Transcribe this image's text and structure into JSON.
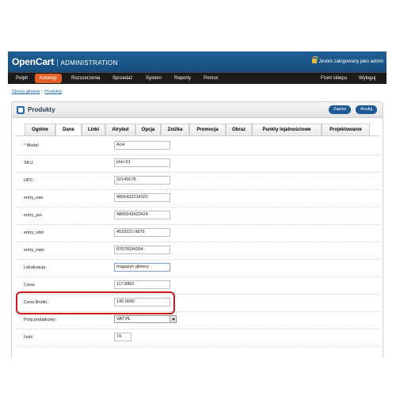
{
  "header": {
    "brand": "OpenCart",
    "separator": "|",
    "admin_label": "ADMINISTRATION",
    "logged_in": "Jesteś zalogowany jako admin"
  },
  "nav": {
    "items": [
      {
        "label": "Pulpit",
        "active": false
      },
      {
        "label": "Katalogi",
        "active": true
      },
      {
        "label": "Rozszerzenia",
        "active": false
      },
      {
        "label": "Sprzedaż",
        "active": false
      },
      {
        "label": "System",
        "active": false
      },
      {
        "label": "Raporty",
        "active": false
      },
      {
        "label": "Pomoc",
        "active": false
      }
    ],
    "right": [
      {
        "label": "Front sklepu"
      },
      {
        "label": "Wyloguj"
      }
    ]
  },
  "breadcrumb": {
    "home": "Strona główna",
    "separator": "::",
    "current": "Produkty"
  },
  "panel": {
    "title": "Produkty",
    "save_label": "Zapisz",
    "cancel_label": "Anuluj"
  },
  "tabs": [
    {
      "label": "Ogólne",
      "active": false
    },
    {
      "label": "Dane",
      "active": true
    },
    {
      "label": "Linki",
      "active": false
    },
    {
      "label": "Atrybut",
      "active": false
    },
    {
      "label": "Opcja",
      "active": false
    },
    {
      "label": "Zniżka",
      "active": false
    },
    {
      "label": "Promocja",
      "active": false
    },
    {
      "label": "Obraz",
      "active": false
    },
    {
      "label": "Punkty lojalnościowe",
      "active": false
    },
    {
      "label": "Projektowanie",
      "active": false
    }
  ],
  "form": {
    "fields": [
      {
        "label": "Model",
        "required": true,
        "value": "AcH"
      },
      {
        "label": "SKU:",
        "value": "khH-01"
      },
      {
        "label": "UPC:",
        "value": "32145678"
      },
      {
        "label": "entry_ean",
        "value": "4856432234322"
      },
      {
        "label": "entry_jan",
        "value": "4865643423424"
      },
      {
        "label": "entry_isbn",
        "value": "4533221-9876"
      },
      {
        "label": "entry_mpn",
        "value": "87675534354"
      },
      {
        "label": "Lokalizacja:",
        "value": "magazyn główny"
      },
      {
        "label": "Cena:",
        "value": "117.8862"
      },
      {
        "label": "Cena Brutto:",
        "value": "145.0000"
      },
      {
        "label": "Próg podatkowy:",
        "value": "VAT PL"
      },
      {
        "label": "Ilość:",
        "value": "74"
      }
    ]
  },
  "colors": {
    "header_blue": "#1f5f95",
    "nav_dark": "#1b1b1b",
    "nav_active": "#e25f26",
    "button_blue": "#1e5b96",
    "highlight_red": "#d11818"
  }
}
